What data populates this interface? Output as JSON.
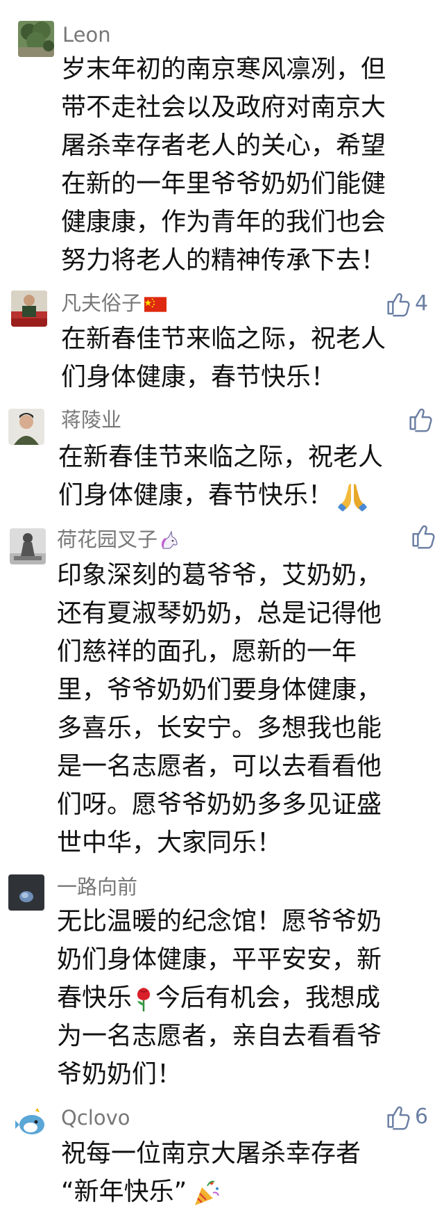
{
  "comments": [
    {
      "name": "Leon",
      "lines": [
        "岁末年初的南京寒风凛冽，但",
        "带不走社会以及政府对南京大",
        "屠杀幸存者老人的关心，希望",
        "在新的一年里爷爷奶奶们能健",
        "健康康，作为青年的我们也会",
        "努力将老人的精神传承下去！"
      ],
      "avatar_icon": "tree-photo-avatar"
    },
    {
      "name": "凡夫俗子",
      "name_icon": "china-flag-icon",
      "lines": [
        "在新春佳节来临之际，祝老人",
        "们身体健康，春节快乐！"
      ],
      "likes": "4",
      "avatar_icon": "person-photo-avatar"
    },
    {
      "name": "蒋陵业",
      "lines": [
        "在新春佳节来临之际，祝老人",
        "们身体健康，春节快乐！"
      ],
      "line_end_icon": "folded-hands-icon",
      "avatar_icon": "portrait-avatar"
    },
    {
      "name": "荷花园叉子",
      "name_icon": "unicorn-icon",
      "lines": [
        "印象深刻的葛爷爷，艾奶奶，",
        "还有夏淑琴奶奶，总是记得他",
        "们慈祥的面孔，愿新的一年",
        "里，爷爷奶奶们要身体健康，",
        "多喜乐，长安宁。多想我也能",
        "是一名志愿者，可以去看看他",
        "们呀。愿爷爷奶奶多多见证盛",
        "世中华，大家同乐！"
      ],
      "avatar_icon": "statue-avatar"
    },
    {
      "name": "一路向前",
      "lines_before": [
        "无比温暖的纪念馆！愿爷爷奶",
        "奶们身体健康，平平安安，新"
      ],
      "line_with_icon": [
        "春快乐",
        "今后有机会，我想成"
      ],
      "lines_after": [
        "为一名志愿者，亲自去看看爷",
        "爷奶奶们！"
      ],
      "inline_icon": "rose-icon",
      "avatar_icon": "dark-avatar"
    },
    {
      "name": "Qclovo",
      "lines": [
        "祝每一位南京大屠杀幸存者"
      ],
      "last_line": "“新年快乐”",
      "last_icon": "party-popper-icon",
      "likes": "6",
      "avatar_icon": "cartoon-fish-avatar"
    }
  ],
  "colors": {
    "name": "#777777",
    "text": "#111111",
    "like": "#6b7fa3"
  }
}
